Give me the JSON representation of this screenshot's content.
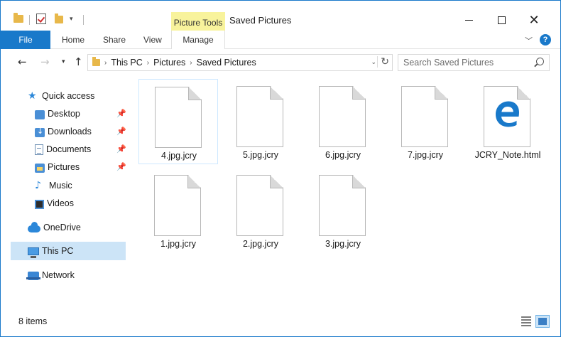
{
  "window": {
    "title": "Saved Pictures",
    "context_tab": "Picture Tools"
  },
  "ribbon": {
    "tabs": [
      "File",
      "Home",
      "Share",
      "View",
      "Manage"
    ]
  },
  "address": {
    "crumbs": [
      "This PC",
      "Pictures",
      "Saved Pictures"
    ]
  },
  "search": {
    "placeholder": "Search Saved Pictures"
  },
  "sidebar": {
    "items": [
      {
        "label": "Quick access"
      },
      {
        "label": "Desktop"
      },
      {
        "label": "Downloads"
      },
      {
        "label": "Documents"
      },
      {
        "label": "Pictures"
      },
      {
        "label": "Music"
      },
      {
        "label": "Videos"
      },
      {
        "label": "OneDrive"
      },
      {
        "label": "This PC"
      },
      {
        "label": "Network"
      }
    ]
  },
  "files": [
    {
      "name": "4.jpg.jcry",
      "icon": "blank-file-icon"
    },
    {
      "name": "5.jpg.jcry",
      "icon": "blank-file-icon"
    },
    {
      "name": "6.jpg.jcry",
      "icon": "blank-file-icon"
    },
    {
      "name": "7.jpg.jcry",
      "icon": "blank-file-icon"
    },
    {
      "name": "JCRY_Note.html",
      "icon": "edge-html-icon"
    },
    {
      "name": "1.jpg.jcry",
      "icon": "blank-file-icon"
    },
    {
      "name": "2.jpg.jcry",
      "icon": "blank-file-icon"
    },
    {
      "name": "3.jpg.jcry",
      "icon": "blank-file-icon"
    }
  ],
  "status": {
    "count": "8 items"
  },
  "colors": {
    "accent": "#1979ca",
    "context_tab": "#f8f39c",
    "selection": "#cce4f7"
  }
}
